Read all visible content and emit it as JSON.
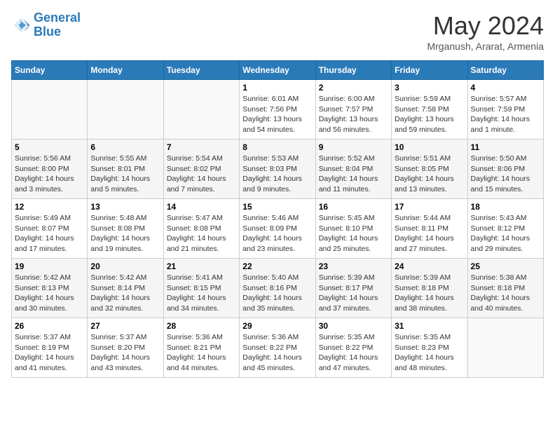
{
  "header": {
    "logo_line1": "General",
    "logo_line2": "Blue",
    "month": "May 2024",
    "location": "Mrganush, Ararat, Armenia"
  },
  "weekdays": [
    "Sunday",
    "Monday",
    "Tuesday",
    "Wednesday",
    "Thursday",
    "Friday",
    "Saturday"
  ],
  "weeks": [
    [
      {
        "day": "",
        "info": ""
      },
      {
        "day": "",
        "info": ""
      },
      {
        "day": "",
        "info": ""
      },
      {
        "day": "1",
        "info": "Sunrise: 6:01 AM\nSunset: 7:56 PM\nDaylight: 13 hours\nand 54 minutes."
      },
      {
        "day": "2",
        "info": "Sunrise: 6:00 AM\nSunset: 7:57 PM\nDaylight: 13 hours\nand 56 minutes."
      },
      {
        "day": "3",
        "info": "Sunrise: 5:59 AM\nSunset: 7:58 PM\nDaylight: 13 hours\nand 59 minutes."
      },
      {
        "day": "4",
        "info": "Sunrise: 5:57 AM\nSunset: 7:59 PM\nDaylight: 14 hours\nand 1 minute."
      }
    ],
    [
      {
        "day": "5",
        "info": "Sunrise: 5:56 AM\nSunset: 8:00 PM\nDaylight: 14 hours\nand 3 minutes."
      },
      {
        "day": "6",
        "info": "Sunrise: 5:55 AM\nSunset: 8:01 PM\nDaylight: 14 hours\nand 5 minutes."
      },
      {
        "day": "7",
        "info": "Sunrise: 5:54 AM\nSunset: 8:02 PM\nDaylight: 14 hours\nand 7 minutes."
      },
      {
        "day": "8",
        "info": "Sunrise: 5:53 AM\nSunset: 8:03 PM\nDaylight: 14 hours\nand 9 minutes."
      },
      {
        "day": "9",
        "info": "Sunrise: 5:52 AM\nSunset: 8:04 PM\nDaylight: 14 hours\nand 11 minutes."
      },
      {
        "day": "10",
        "info": "Sunrise: 5:51 AM\nSunset: 8:05 PM\nDaylight: 14 hours\nand 13 minutes."
      },
      {
        "day": "11",
        "info": "Sunrise: 5:50 AM\nSunset: 8:06 PM\nDaylight: 14 hours\nand 15 minutes."
      }
    ],
    [
      {
        "day": "12",
        "info": "Sunrise: 5:49 AM\nSunset: 8:07 PM\nDaylight: 14 hours\nand 17 minutes."
      },
      {
        "day": "13",
        "info": "Sunrise: 5:48 AM\nSunset: 8:08 PM\nDaylight: 14 hours\nand 19 minutes."
      },
      {
        "day": "14",
        "info": "Sunrise: 5:47 AM\nSunset: 8:08 PM\nDaylight: 14 hours\nand 21 minutes."
      },
      {
        "day": "15",
        "info": "Sunrise: 5:46 AM\nSunset: 8:09 PM\nDaylight: 14 hours\nand 23 minutes."
      },
      {
        "day": "16",
        "info": "Sunrise: 5:45 AM\nSunset: 8:10 PM\nDaylight: 14 hours\nand 25 minutes."
      },
      {
        "day": "17",
        "info": "Sunrise: 5:44 AM\nSunset: 8:11 PM\nDaylight: 14 hours\nand 27 minutes."
      },
      {
        "day": "18",
        "info": "Sunrise: 5:43 AM\nSunset: 8:12 PM\nDaylight: 14 hours\nand 29 minutes."
      }
    ],
    [
      {
        "day": "19",
        "info": "Sunrise: 5:42 AM\nSunset: 8:13 PM\nDaylight: 14 hours\nand 30 minutes."
      },
      {
        "day": "20",
        "info": "Sunrise: 5:42 AM\nSunset: 8:14 PM\nDaylight: 14 hours\nand 32 minutes."
      },
      {
        "day": "21",
        "info": "Sunrise: 5:41 AM\nSunset: 8:15 PM\nDaylight: 14 hours\nand 34 minutes."
      },
      {
        "day": "22",
        "info": "Sunrise: 5:40 AM\nSunset: 8:16 PM\nDaylight: 14 hours\nand 35 minutes."
      },
      {
        "day": "23",
        "info": "Sunrise: 5:39 AM\nSunset: 8:17 PM\nDaylight: 14 hours\nand 37 minutes."
      },
      {
        "day": "24",
        "info": "Sunrise: 5:39 AM\nSunset: 8:18 PM\nDaylight: 14 hours\nand 38 minutes."
      },
      {
        "day": "25",
        "info": "Sunrise: 5:38 AM\nSunset: 8:18 PM\nDaylight: 14 hours\nand 40 minutes."
      }
    ],
    [
      {
        "day": "26",
        "info": "Sunrise: 5:37 AM\nSunset: 8:19 PM\nDaylight: 14 hours\nand 41 minutes."
      },
      {
        "day": "27",
        "info": "Sunrise: 5:37 AM\nSunset: 8:20 PM\nDaylight: 14 hours\nand 43 minutes."
      },
      {
        "day": "28",
        "info": "Sunrise: 5:36 AM\nSunset: 8:21 PM\nDaylight: 14 hours\nand 44 minutes."
      },
      {
        "day": "29",
        "info": "Sunrise: 5:36 AM\nSunset: 8:22 PM\nDaylight: 14 hours\nand 45 minutes."
      },
      {
        "day": "30",
        "info": "Sunrise: 5:35 AM\nSunset: 8:22 PM\nDaylight: 14 hours\nand 47 minutes."
      },
      {
        "day": "31",
        "info": "Sunrise: 5:35 AM\nSunset: 8:23 PM\nDaylight: 14 hours\nand 48 minutes."
      },
      {
        "day": "",
        "info": ""
      }
    ]
  ]
}
